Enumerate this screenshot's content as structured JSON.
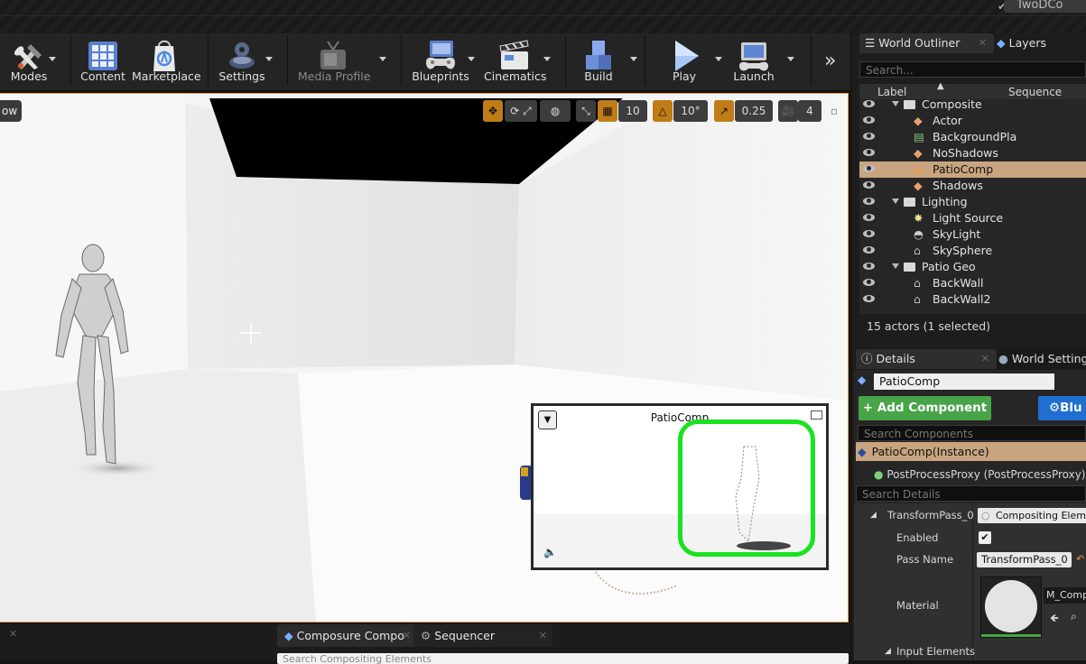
{
  "title_strip": {
    "project_tab": "TwoDCo"
  },
  "toolbar": {
    "items": [
      {
        "label": "Modes",
        "icon": "modes-icon"
      },
      {
        "label": "Content",
        "icon": "content-icon"
      },
      {
        "label": "Marketplace",
        "icon": "marketplace-icon"
      },
      {
        "label": "Settings",
        "icon": "settings-icon"
      },
      {
        "label": "Media Profile",
        "icon": "media-profile-icon"
      },
      {
        "label": "Blueprints",
        "icon": "blueprints-icon"
      },
      {
        "label": "Cinematics",
        "icon": "cinematics-icon"
      },
      {
        "label": "Build",
        "icon": "build-icon"
      },
      {
        "label": "Play",
        "icon": "play-icon"
      },
      {
        "label": "Launch",
        "icon": "launch-icon"
      }
    ],
    "overflow": "»"
  },
  "viewport": {
    "view_button": "ow",
    "grid_snap": "10",
    "rotation_snap": "10°",
    "scale_snap": "0.25",
    "camera_speed": "4"
  },
  "preview": {
    "title": "PatioComp",
    "highlight_color": "#19e21f"
  },
  "bottom_tabs": {
    "composure": "Composure Compo",
    "sequencer": "Sequencer",
    "search_placeholder": "Search Compositing Elements"
  },
  "outliner": {
    "tab_world_outliner": "World Outliner",
    "tab_layers": "Layers",
    "search_placeholder": "Search...",
    "col_label": "Label",
    "col_sequence": "Sequence",
    "rows": [
      {
        "label": "Composite",
        "depth": 0,
        "kind": "folder"
      },
      {
        "label": "Actor",
        "depth": 1,
        "kind": "actor"
      },
      {
        "label": "BackgroundPla",
        "depth": 1,
        "kind": "film"
      },
      {
        "label": "NoShadows",
        "depth": 1,
        "kind": "actor"
      },
      {
        "label": "PatioComp",
        "depth": 1,
        "kind": "comp",
        "selected": true
      },
      {
        "label": "Shadows",
        "depth": 1,
        "kind": "actor"
      },
      {
        "label": "Lighting",
        "depth": 0,
        "kind": "folder"
      },
      {
        "label": "Light Source",
        "depth": 1,
        "kind": "light"
      },
      {
        "label": "SkyLight",
        "depth": 1,
        "kind": "skylight"
      },
      {
        "label": "SkySphere",
        "depth": 1,
        "kind": "mesh"
      },
      {
        "label": "Patio Geo",
        "depth": 0,
        "kind": "folder"
      },
      {
        "label": "BackWall",
        "depth": 1,
        "kind": "mesh"
      },
      {
        "label": "BackWall2",
        "depth": 1,
        "kind": "mesh"
      }
    ],
    "status": "15 actors (1 selected)"
  },
  "details": {
    "tab_details": "Details",
    "tab_world_settings": "World Settings",
    "name_value": "PatioComp",
    "add_component": "+ Add Component",
    "blueprint_btn": "Blu",
    "search_components_placeholder": "Search Components",
    "instance_row": "PatioComp(Instance)",
    "component_row": "PostProcessProxy (PostProcessProxy) (",
    "search_details_placeholder": "Search Details",
    "transform_pass": "TransformPass_0",
    "compositing_element": "Compositing Elemen",
    "enabled_label": "Enabled",
    "pass_name_label": "Pass Name",
    "pass_name_value": "TransformPass_0",
    "material_label": "Material",
    "material_value": "M_Comp",
    "input_elements": "Input Elements"
  }
}
